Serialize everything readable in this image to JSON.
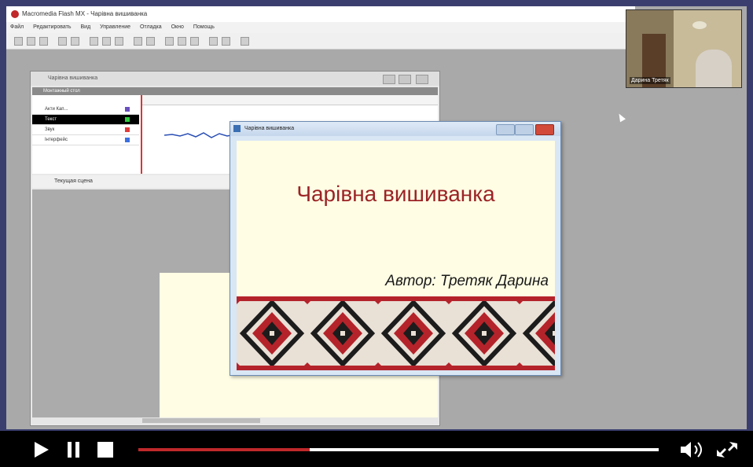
{
  "app": {
    "title": "Macromedia Flash MX - Чарівна вишиванка",
    "menu": [
      "Файл",
      "Редактировать",
      "Вид",
      "Управление",
      "Отладка",
      "Окно",
      "Помощь"
    ]
  },
  "flash_doc": {
    "title": "Чарівна вишиванка",
    "timeline_label": "Монтажный стол",
    "layers": [
      "Акти Кап...",
      "Текст",
      "Звук",
      "Інтерфейс"
    ],
    "scene_label": "Текущая сцена"
  },
  "swf_window": {
    "title": "Чарівна вишиванка",
    "heading": "Чарівна вишиванка",
    "author": "Автор: Третяк Дарина"
  },
  "webcam": {
    "name": "Дарина Третяк"
  },
  "player": {
    "progress_fraction": 0.33
  },
  "colors": {
    "heading_red": "#9b2326",
    "progress_red": "#c0282a",
    "canvas_bg": "#fffde4"
  }
}
